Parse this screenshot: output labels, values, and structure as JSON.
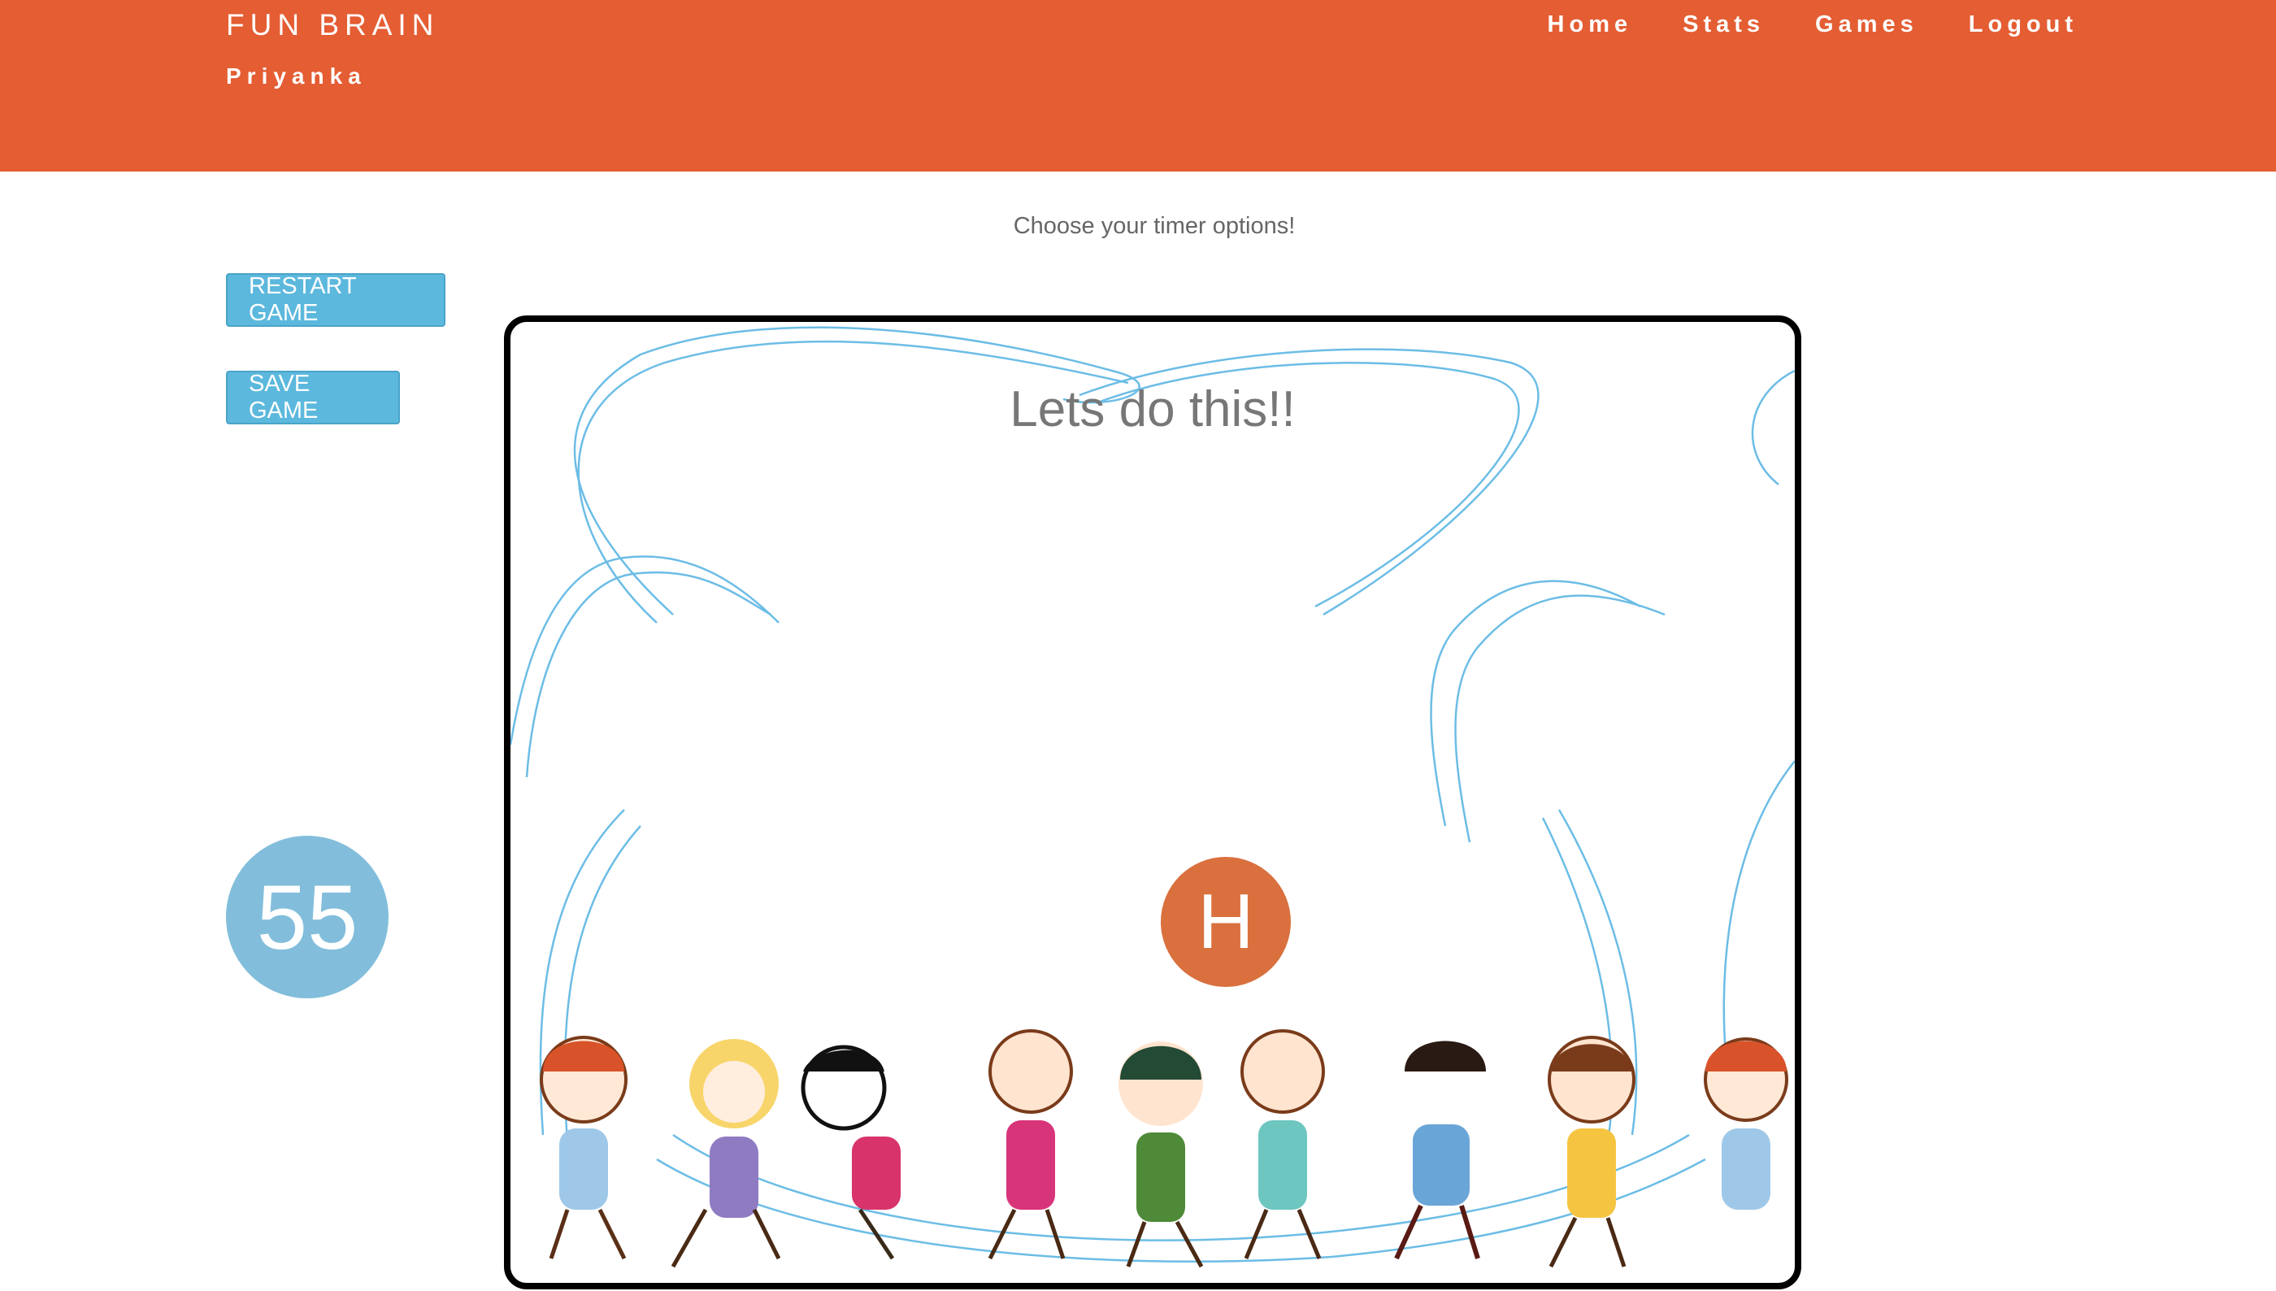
{
  "header": {
    "brand": "FUN BRAIN",
    "username": "Priyanka",
    "nav": [
      {
        "label": "Home"
      },
      {
        "label": "Stats"
      },
      {
        "label": "Games"
      },
      {
        "label": "Logout"
      }
    ]
  },
  "main": {
    "subtitle": "Choose your timer options!",
    "restart_label": "RESTART GAME",
    "save_label": "SAVE GAME",
    "timer_value": "55"
  },
  "board": {
    "title": "Lets do this!!",
    "letter": "H",
    "illustration": "children-holding-hands-illustration"
  },
  "colors": {
    "header_bg": "#e45d33",
    "button_bg": "#5cb8dd",
    "timer_bg": "#82bedb",
    "letter_ball_bg": "#d9703e",
    "swirl_stroke": "#6cbde6"
  }
}
